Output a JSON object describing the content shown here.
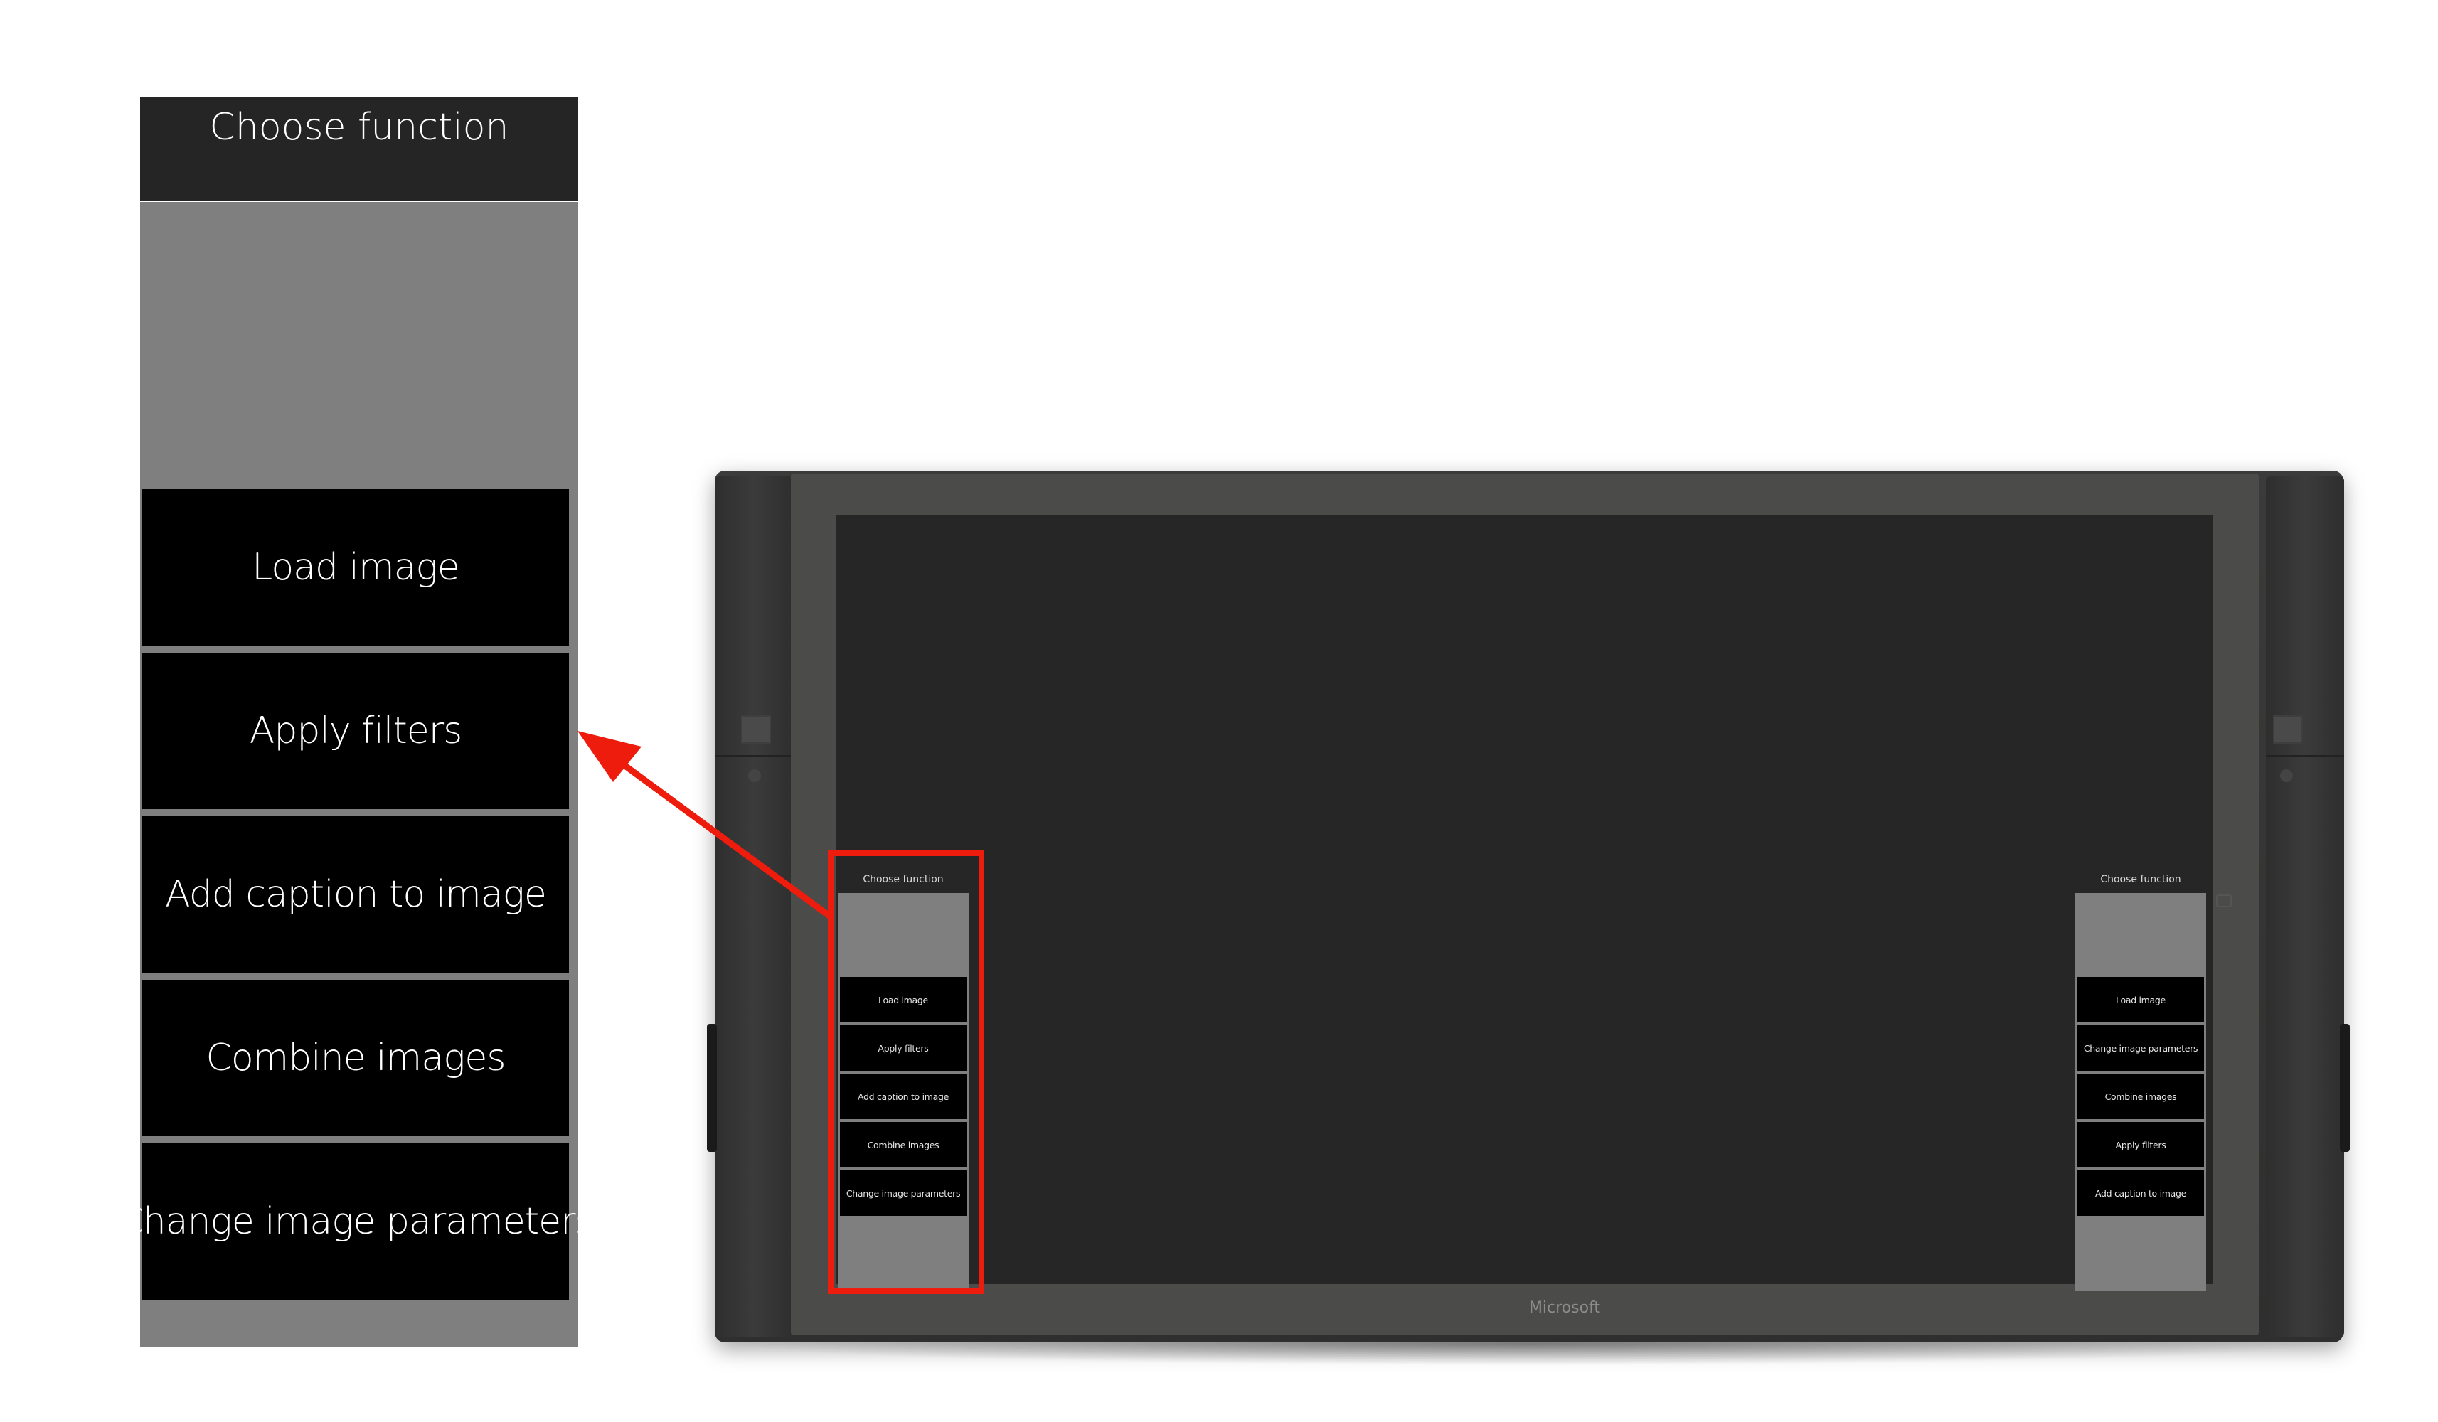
{
  "zoomed_menu": {
    "title": "Choose function",
    "buttons": [
      {
        "label": "Load image"
      },
      {
        "label": "Apply filters"
      },
      {
        "label": "Add caption to image"
      },
      {
        "label": "Combine images"
      },
      {
        "label": "Change image parameters"
      }
    ]
  },
  "device": {
    "brand": "Microsoft",
    "left_menu": {
      "title": "Choose function",
      "buttons": [
        {
          "label": "Load image"
        },
        {
          "label": "Apply filters"
        },
        {
          "label": "Add caption to image"
        },
        {
          "label": "Combine images"
        },
        {
          "label": "Change image parameters"
        }
      ]
    },
    "right_menu": {
      "title": "Choose function",
      "buttons": [
        {
          "label": "Load image"
        },
        {
          "label": "Change image parameters"
        },
        {
          "label": "Combine images"
        },
        {
          "label": "Apply filters"
        },
        {
          "label": "Add caption to image"
        }
      ]
    }
  },
  "colors": {
    "highlight": "#ee1c0d",
    "menu_panel": "#7f7f7f",
    "button_bg": "#000000",
    "screen_bg": "#262626"
  }
}
